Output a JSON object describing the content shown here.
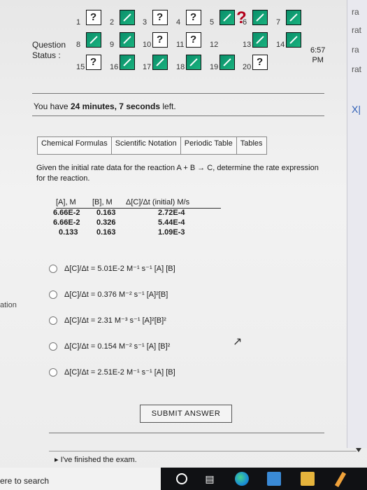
{
  "question_status": {
    "label_question": "Question",
    "label_status": "Status :",
    "big_mark": "?",
    "items": [
      {
        "n": "1",
        "state": "q"
      },
      {
        "n": "2",
        "state": "check"
      },
      {
        "n": "3",
        "state": "q"
      },
      {
        "n": "4",
        "state": "q"
      },
      {
        "n": "5",
        "state": "check"
      },
      {
        "n": "6",
        "state": "check"
      },
      {
        "n": "7",
        "state": "check"
      },
      {
        "n": "8",
        "state": "check"
      },
      {
        "n": "9",
        "state": "check"
      },
      {
        "n": "10",
        "state": "q"
      },
      {
        "n": "11",
        "state": "q"
      },
      {
        "n": "12",
        "state": "big"
      },
      {
        "n": "13",
        "state": "check"
      },
      {
        "n": "14",
        "state": "check"
      },
      {
        "n": "15",
        "state": "q"
      },
      {
        "n": "16",
        "state": "check"
      },
      {
        "n": "17",
        "state": "check"
      },
      {
        "n": "18",
        "state": "check"
      },
      {
        "n": "19",
        "state": "check"
      },
      {
        "n": "20",
        "state": "q"
      }
    ]
  },
  "clock": {
    "time": "6:57",
    "ampm": "PM"
  },
  "timer": {
    "prefix": "You have",
    "value": "24 minutes, 7 seconds",
    "suffix": "left."
  },
  "tabs": [
    "Chemical Formulas",
    "Scientific Notation",
    "Periodic Table",
    "Tables"
  ],
  "question_text": "Given the initial rate data for the reaction A + B → C, determine the rate expression for the reaction.",
  "table": {
    "headers": [
      "[A], M",
      "[B], M",
      "Δ[C]/Δt (initial) M/s"
    ],
    "rows": [
      [
        "6.66E-2",
        "0.163",
        "2.72E-4"
      ],
      [
        "6.66E-2",
        "0.326",
        "5.44E-4"
      ],
      [
        "0.133",
        "0.163",
        "1.09E-3"
      ]
    ]
  },
  "options": [
    "Δ[C]/Δt = 5.01E-2 M⁻¹ s⁻¹ [A] [B]",
    "Δ[C]/Δt = 0.376 M⁻² s⁻¹ [A]²[B]",
    "Δ[C]/Δt = 2.31 M⁻³ s⁻¹ [A]²[B]²",
    "Δ[C]/Δt = 0.154 M⁻² s⁻¹ [A] [B]²",
    "Δ[C]/Δt = 2.51E-2 M⁻¹ s⁻¹ [A] [B]"
  ],
  "submit_label": "SUBMIT ANSWER",
  "finished_label": "▸ I've finished the exam.",
  "edge_text": {
    "right": [
      "ra",
      "rat",
      "ra",
      "rat",
      "X|"
    ],
    "left": "ation"
  },
  "taskbar": {
    "search_text": "ere to search"
  },
  "colors": {
    "check": "#0a8f6a",
    "big_mark": "#b3001b",
    "taskbar": "#101114"
  }
}
